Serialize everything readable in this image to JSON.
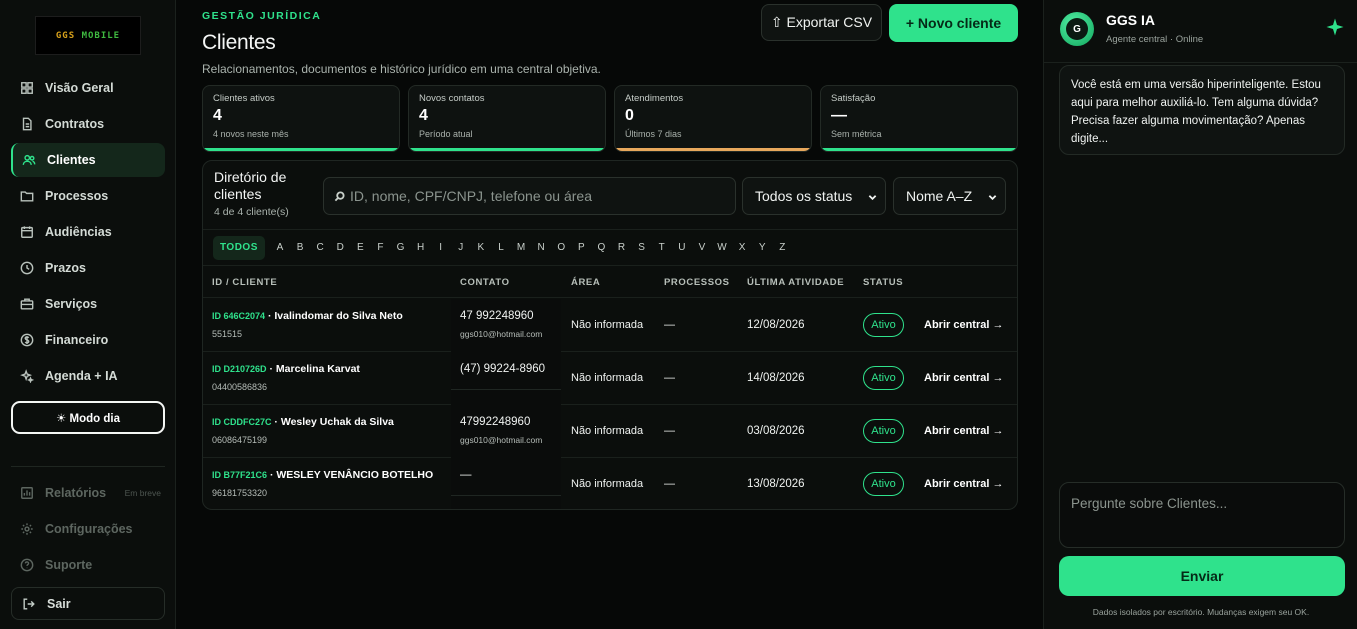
{
  "brand": {
    "logo_text_gold": "GGS",
    "logo_text_green": "MOBILE"
  },
  "sidebar": {
    "items": [
      {
        "label": "Visão Geral",
        "icon": "grid-icon"
      },
      {
        "label": "Contratos",
        "icon": "file-icon"
      },
      {
        "label": "Clientes",
        "icon": "users-icon",
        "active": true
      },
      {
        "label": "Processos",
        "icon": "folder-icon"
      },
      {
        "label": "Audiências",
        "icon": "calendar-icon"
      },
      {
        "label": "Prazos",
        "icon": "clock-icon"
      },
      {
        "label": "Serviços",
        "icon": "briefcase-icon"
      },
      {
        "label": "Financeiro",
        "icon": "dollar-icon"
      },
      {
        "label": "Agenda + IA",
        "icon": "sparkle-icon"
      }
    ],
    "mode_label": "☀ Modo dia",
    "secondary": [
      {
        "label": "Relatórios",
        "badge": "Em breve"
      },
      {
        "label": "Configurações"
      },
      {
        "label": "Suporte"
      }
    ],
    "logout_label": "Sair"
  },
  "header": {
    "eyebrow": "GESTÃO JURÍDICA",
    "title": "Clientes",
    "subtitle": "Relacionamentos, documentos e histórico jurídico em uma central objetiva.",
    "export_label": "⇧ Exportar CSV",
    "new_label": "+  Novo cliente"
  },
  "stats": [
    {
      "label": "Clientes ativos",
      "value": "4",
      "note": "4 novos neste mês",
      "accent": "#2fe28c"
    },
    {
      "label": "Novos contatos",
      "value": "4",
      "note": "Período atual",
      "accent": "#2fe28c"
    },
    {
      "label": "Atendimentos",
      "value": "0",
      "note": "Últimos 7 dias",
      "accent": "#e8a85c"
    },
    {
      "label": "Satisfação",
      "value": "—",
      "note": "Sem métrica",
      "accent": "#2fe28c"
    }
  ],
  "directory": {
    "title": "Diretório de clientes",
    "count": "4 de 4 cliente(s)",
    "search_placeholder": "ID, nome, CPF/CNPJ, telefone ou área",
    "status_select": "Todos os status",
    "sort_select": "Nome A–Z",
    "alpha_all": "TODOS",
    "letters": [
      "A",
      "B",
      "C",
      "D",
      "E",
      "F",
      "G",
      "H",
      "I",
      "J",
      "K",
      "L",
      "M",
      "N",
      "O",
      "P",
      "Q",
      "R",
      "S",
      "T",
      "U",
      "V",
      "W",
      "X",
      "Y",
      "Z"
    ],
    "columns": [
      "ID / CLIENTE",
      "CONTATO",
      "ÁREA",
      "PROCESSOS",
      "ÚLTIMA ATIVIDADE",
      "STATUS"
    ],
    "rows": [
      {
        "id": "ID 646C2074",
        "name": "Ivalindomar do Silva Neto",
        "doc": "551515",
        "phone": "47 992248960",
        "email": "ggs010@hotmail.com",
        "area": "Não informada",
        "processes": "—",
        "last_activity": "12/08/2026",
        "status": "Ativo",
        "action": "Abrir central →"
      },
      {
        "id": "ID D210726D",
        "name": "Marcelina Karvat",
        "doc": "04400586836",
        "phone": "(47) 99224-8960",
        "email": "",
        "area": "Não informada",
        "processes": "—",
        "last_activity": "14/08/2026",
        "status": "Ativo",
        "action": "Abrir central →"
      },
      {
        "id": "ID CDDFC27C",
        "name": "Wesley Uchak da Silva",
        "doc": "06086475199",
        "phone": "47992248960",
        "email": "ggs010@hotmail.com",
        "area": "Não informada",
        "processes": "—",
        "last_activity": "03/08/2026",
        "status": "Ativo",
        "action": "Abrir central →"
      },
      {
        "id": "ID B77F21C6",
        "name": "WESLEY VENÂNCIO BOTELHO",
        "doc": "96181753320",
        "phone": "—",
        "email": "",
        "area": "Não informada",
        "processes": "—",
        "last_activity": "13/08/2026",
        "status": "Ativo",
        "action": "Abrir central →"
      }
    ]
  },
  "assistant": {
    "name": "GGS IA",
    "avatar_letter": "G",
    "status": "Agente central · Online",
    "message": "Você está em uma versão hiperinteligente. Estou aqui para melhor auxiliá-lo. Tem alguma dúvida? Precisa fazer alguma movimentação? Apenas digite...",
    "input_placeholder": "Pergunte sobre Clientes...",
    "send_label": "Enviar",
    "footnote": "Dados isolados por escritório. Mudanças exigem seu OK."
  },
  "colors": {
    "accent": "#2fe28c",
    "warning": "#e8a85c",
    "background": "#060807"
  }
}
